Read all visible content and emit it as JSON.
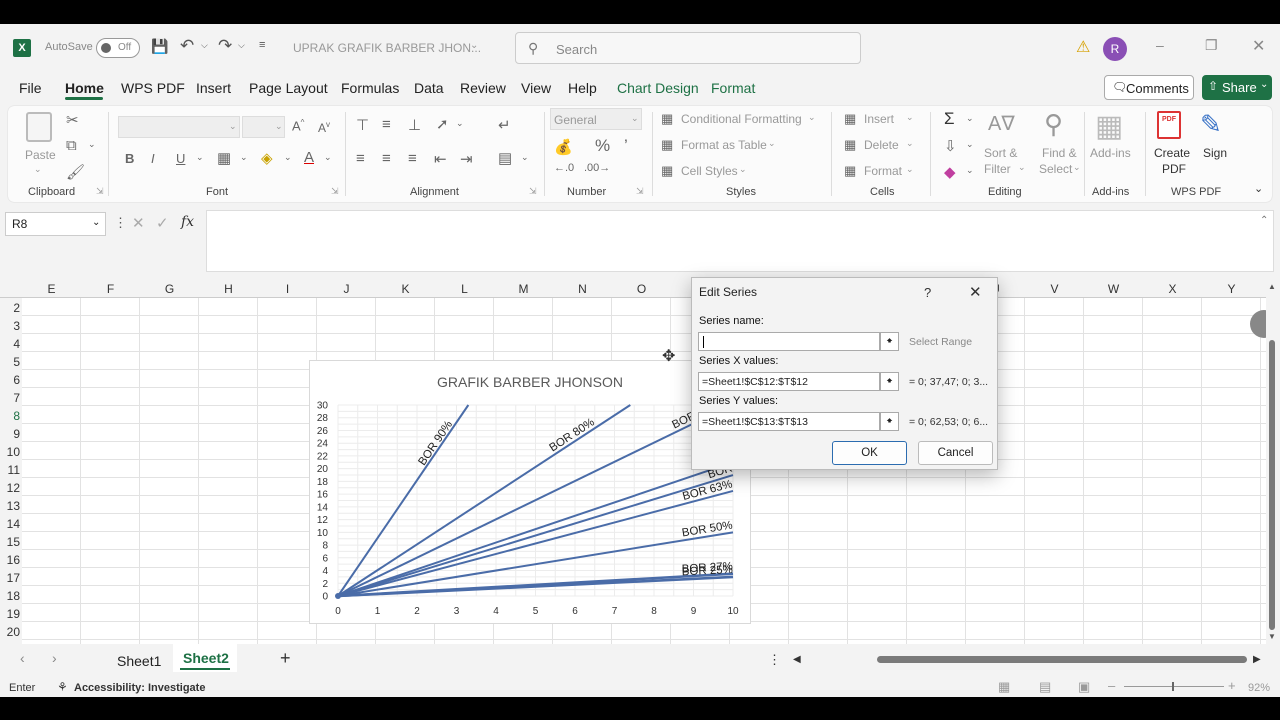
{
  "title_bar": {
    "autosave_label": "AutoSave",
    "autosave_state": "Off",
    "file_name": "UPRAK GRAFIK BARBER JHON...",
    "search_placeholder": "Search",
    "user_initial": "R"
  },
  "menu": {
    "items": [
      "File",
      "Home",
      "WPS PDF",
      "Insert",
      "Page Layout",
      "Formulas",
      "Data",
      "Review",
      "View",
      "Help",
      "Chart Design",
      "Format"
    ],
    "comments_label": "Comments",
    "share_label": "Share"
  },
  "ribbon": {
    "clipboard": {
      "paste": "Paste",
      "label": "Clipboard"
    },
    "font": {
      "label": "Font"
    },
    "alignment": {
      "label": "Alignment"
    },
    "number": {
      "format": "General",
      "label": "Number"
    },
    "styles": {
      "conditional": "Conditional Formatting",
      "format_table": "Format as Table",
      "cell_styles": "Cell Styles",
      "label": "Styles"
    },
    "cells": {
      "insert": "Insert",
      "delete": "Delete",
      "format": "Format",
      "label": "Cells"
    },
    "editing": {
      "sort": "Sort &",
      "filter": "Filter",
      "find": "Find &",
      "select": "Select",
      "label": "Editing"
    },
    "addins": {
      "addins": "Add-ins",
      "label": "Add-ins"
    },
    "wps": {
      "create": "Create",
      "pdf": "PDF",
      "sign": "Sign",
      "label": "WPS PDF"
    }
  },
  "formula_bar": {
    "name_box": "R8",
    "fx": "fx"
  },
  "columns": [
    "E",
    "F",
    "G",
    "H",
    "I",
    "J",
    "K",
    "L",
    "M",
    "N",
    "O",
    "P",
    "Q",
    "R",
    "S",
    "T",
    "U",
    "V",
    "W",
    "X",
    "Y"
  ],
  "rows": [
    "2",
    "3",
    "4",
    "5",
    "6",
    "7",
    "8",
    "9",
    "10",
    "11",
    "12",
    "13",
    "14",
    "15",
    "16",
    "17",
    "18",
    "19",
    "20"
  ],
  "chart_data": {
    "type": "line",
    "title": "GRAFIK BARBER JHONSON",
    "xlim": [
      0,
      10
    ],
    "ylim": [
      0,
      30
    ],
    "x_ticks": [
      0,
      1,
      2,
      3,
      4,
      5,
      6,
      7,
      8,
      9,
      10
    ],
    "y_ticks": [
      0,
      2,
      4,
      6,
      8,
      10,
      12,
      14,
      16,
      18,
      20,
      22,
      24,
      26,
      28,
      30
    ],
    "series": [
      {
        "name": "BOR 90%",
        "values": [
          [
            0,
            0
          ],
          [
            3.3,
            30
          ]
        ]
      },
      {
        "name": "BOR 80%",
        "values": [
          [
            0,
            0
          ],
          [
            7.4,
            30
          ]
        ]
      },
      {
        "name": "BOR 7",
        "values": [
          [
            0,
            0
          ],
          [
            9.3,
            28
          ]
        ]
      },
      {
        "name": "BOR",
        "values": [
          [
            0,
            0
          ],
          [
            10,
            21
          ]
        ]
      },
      {
        "name": "BOR",
        "values": [
          [
            0,
            0
          ],
          [
            10,
            19
          ]
        ]
      },
      {
        "name": "BOR 63%",
        "values": [
          [
            0,
            0
          ],
          [
            10,
            16.5
          ]
        ]
      },
      {
        "name": "BOR 50%",
        "values": [
          [
            0,
            0
          ],
          [
            10,
            10
          ]
        ]
      },
      {
        "name": "BOR 27%",
        "values": [
          [
            0,
            0
          ],
          [
            10,
            3.5
          ]
        ]
      },
      {
        "name": "BOR 25%",
        "values": [
          [
            0,
            0
          ],
          [
            10,
            3
          ]
        ]
      }
    ],
    "color": "#4a6ca8",
    "grid": true
  },
  "dialog": {
    "title": "Edit Series",
    "help": "?",
    "series_name_label": "Series name:",
    "series_name_value": "",
    "select_range": "Select Range",
    "x_label": "Series X values:",
    "x_value": "=Sheet1!$C$12:$T$12",
    "x_preview": "= 0; 37,47; 0; 3...",
    "y_label": "Series Y values:",
    "y_value": "=Sheet1!$C$13:$T$13",
    "y_preview": "= 0; 62,53; 0; 6...",
    "ok": "OK",
    "cancel": "Cancel"
  },
  "sheets": {
    "tabs": [
      "Sheet1",
      "Sheet2"
    ],
    "active": "Sheet2"
  },
  "status": {
    "mode": "Enter",
    "accessibility": "Accessibility: Investigate",
    "zoom": "92%"
  }
}
